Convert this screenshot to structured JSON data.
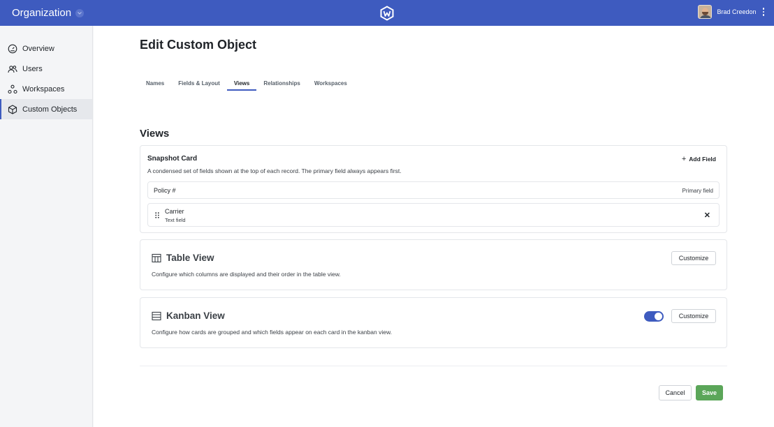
{
  "topbar": {
    "org_label": "Organization",
    "user_name": "Brad Creedon",
    "brand_color": "#3e5bbf"
  },
  "sidebar": {
    "items": [
      {
        "label": "Overview",
        "icon": "gauge-icon"
      },
      {
        "label": "Users",
        "icon": "users-icon"
      },
      {
        "label": "Workspaces",
        "icon": "workspaces-icon"
      },
      {
        "label": "Custom Objects",
        "icon": "cube-icon",
        "active": true
      }
    ]
  },
  "main": {
    "title": "Edit Custom Object",
    "tabs": [
      {
        "label": "Names"
      },
      {
        "label": "Fields & Layout"
      },
      {
        "label": "Views",
        "active": true
      },
      {
        "label": "Relationships"
      },
      {
        "label": "Workspaces"
      }
    ],
    "section_title": "Views",
    "snapshot": {
      "title": "Snapshot Card",
      "description": "A condensed set of fields shown at the top of each record. The primary field always appears first.",
      "add_field_label": "Add Field",
      "primary_field": {
        "name": "Policy #",
        "meta": "Primary field"
      },
      "fields": [
        {
          "name": "Carrier",
          "type": "Text field"
        }
      ]
    },
    "table_view": {
      "title": "Table View",
      "description": "Configure which columns are displayed and their order in the table view.",
      "button_label": "Customize"
    },
    "kanban_view": {
      "title": "Kanban View",
      "description": "Configure how cards are grouped and which fields appear on each card in the kanban view.",
      "button_label": "Customize",
      "enabled": true
    },
    "footer": {
      "cancel_label": "Cancel",
      "save_label": "Save",
      "save_color": "#5ba659"
    }
  }
}
